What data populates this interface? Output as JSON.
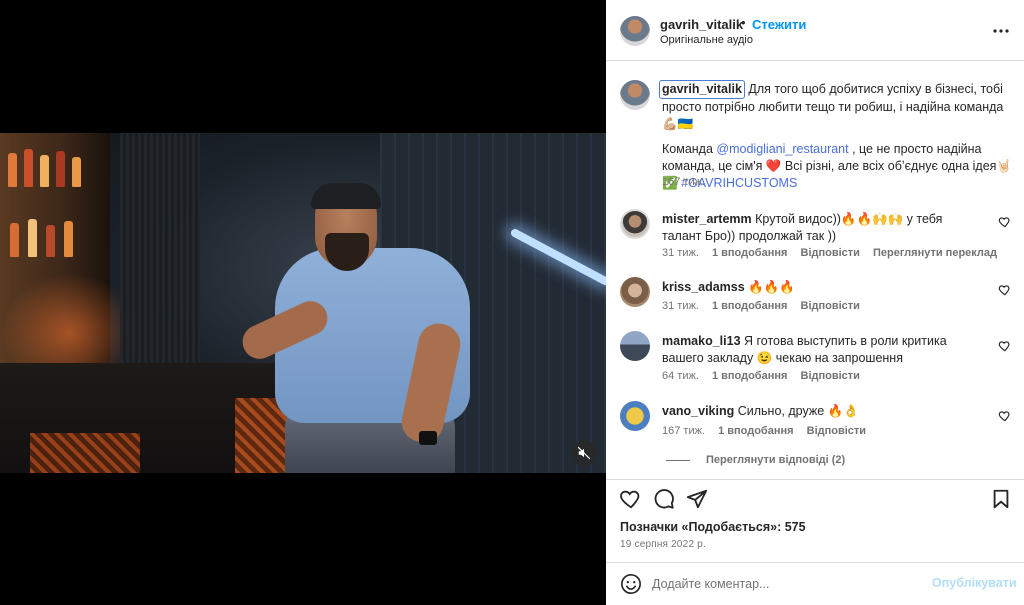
{
  "post": {
    "username": "gavrih_vitalik",
    "dot": "•",
    "follow_label": "Стежити",
    "audio_label": "Оригінальне аудіо",
    "caption_text_1": "Для того щоб добитися успіху в бізнесі, тобі просто потрібно любити тещо ти робиш, і надійна команда💪🏼🇺🇦",
    "caption_text_2a": "Команда ",
    "caption_mention": "@modigliani_restaurant",
    "caption_text_2b": " , це не просто надійна команда, це сім'я ❤️ Всі різні, але всіх обʼєднує одна ідея🤘🏻✅",
    "caption_tag": "#GAVRIHCUSTOMS",
    "caption_time": "167 тиж."
  },
  "comments": [
    {
      "username": "mister_artemm",
      "text": "Крутой видос))🔥🔥🙌🙌 у тебя талант Бро)) продолжай так ))",
      "time": "31 тиж.",
      "likes": "1 вподобання",
      "reply": "Відповісти",
      "translate": "Переглянути переклад"
    },
    {
      "username": "kriss_adamss",
      "text": "🔥🔥🔥",
      "time": "31 тиж.",
      "likes": "1 вподобання",
      "reply": "Відповісти"
    },
    {
      "username": "mamako_li13",
      "text": "Я готова выступить в роли критика вашего закладу 😉 чекаю на запрошення",
      "time": "64 тиж.",
      "likes": "1 вподобання",
      "reply": "Відповісти"
    },
    {
      "username": "vano_viking",
      "text": "Сильно, друже 🔥👌",
      "time": "167 тиж.",
      "likes": "1 вподобання",
      "reply": "Відповісти",
      "view_replies": "Переглянути відповіді (2)"
    }
  ],
  "footer": {
    "likes_label": "Позначки «Подобається»: 575",
    "date": "19 серпня 2022 р.",
    "comment_placeholder": "Додайте коментар...",
    "post_label": "Опублікувати"
  },
  "icons": {
    "more": "more-options-icon",
    "like": "heart-icon",
    "comment": "comment-icon",
    "share": "share-icon",
    "save": "bookmark-icon",
    "emoji": "emoji-icon",
    "mute": "speaker-muted-icon"
  },
  "colors": {
    "accent": "#0095f6",
    "link": "#4a6ee0",
    "muted": "#737373",
    "post_disabled": "#b2dffc"
  }
}
